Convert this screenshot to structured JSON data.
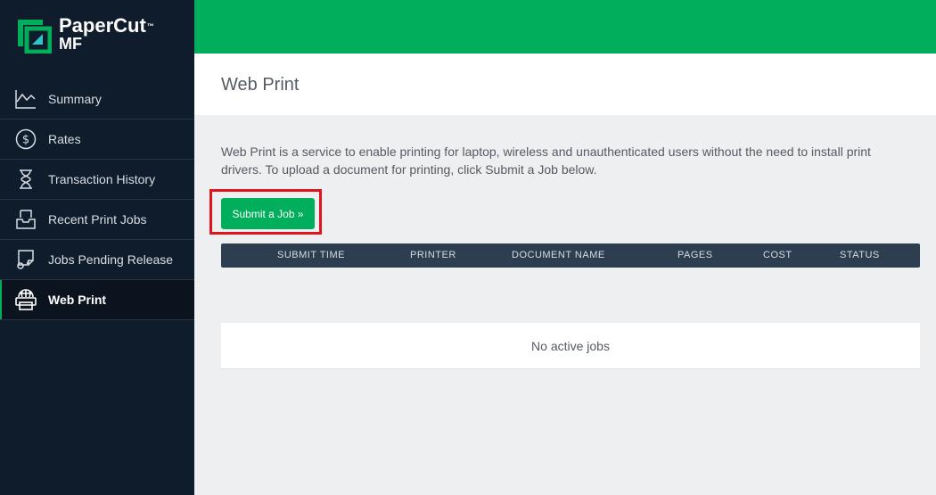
{
  "brand": {
    "name": "PaperCut",
    "trademark": "™",
    "sub": "MF",
    "accent_color": "#00ae5c",
    "sidebar_color": "#0f1c2b"
  },
  "sidebar": {
    "items": [
      {
        "label": "Summary",
        "icon": "line-chart-icon"
      },
      {
        "label": "Rates",
        "icon": "dollar-circle-icon"
      },
      {
        "label": "Transaction History",
        "icon": "hourglass-icon"
      },
      {
        "label": "Recent Print Jobs",
        "icon": "inbox-tray-icon"
      },
      {
        "label": "Jobs Pending Release",
        "icon": "pending-printer-icon"
      },
      {
        "label": "Web Print",
        "icon": "web-printer-icon",
        "active": true
      }
    ]
  },
  "page": {
    "title": "Web Print",
    "description": "Web Print is a service to enable printing for laptop, wireless and unauthenticated users without the need to install print drivers. To upload a document for printing, click Submit a Job below.",
    "submit_label": "Submit a Job »"
  },
  "table": {
    "columns": [
      "SUBMIT TIME",
      "PRINTER",
      "DOCUMENT NAME",
      "PAGES",
      "COST",
      "STATUS"
    ],
    "empty_message": "No active jobs"
  }
}
